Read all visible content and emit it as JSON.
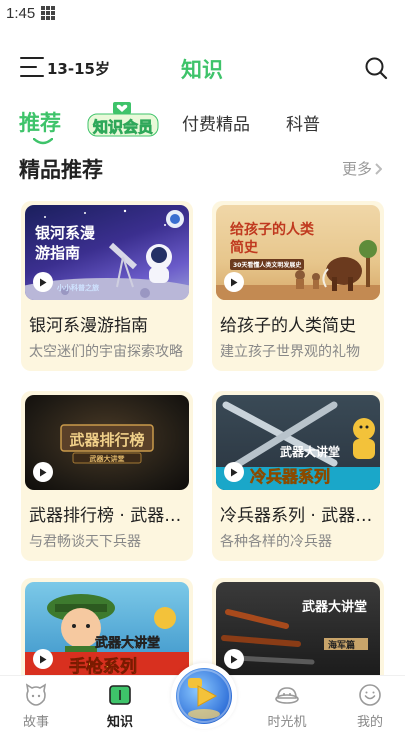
{
  "status_bar": {
    "time": "1:45"
  },
  "header": {
    "age_range": "13-15岁",
    "title": "知识"
  },
  "tabs": [
    {
      "label": "推荐",
      "active": true
    },
    {
      "label": "知识会员",
      "active": false
    },
    {
      "label": "付费精品",
      "active": false
    },
    {
      "label": "科普",
      "active": false
    }
  ],
  "section": {
    "title": "精品推荐",
    "more_label": "更多"
  },
  "cards": [
    {
      "title": "银河系漫游指南",
      "subtitle": "太空迷们的宇宙探索攻略",
      "thumb_text": "银河系漫游指南",
      "thumb_small": "小小科普之旅"
    },
    {
      "title": "给孩子的人类简史",
      "subtitle": "建立孩子世界观的礼物",
      "thumb_text": "给孩子的人类简史",
      "thumb_small": "30天看懂人类文明发展史"
    },
    {
      "title": "武器排行榜 · 武器大讲堂",
      "subtitle": "与君畅谈天下兵器",
      "thumb_text": "武器排行榜",
      "thumb_small": "武器大讲堂"
    },
    {
      "title": "冷兵器系列 · 武器大讲堂",
      "subtitle": "各种各样的冷兵器",
      "thumb_text": "武器大讲堂",
      "thumb_small": "冷兵器系列"
    },
    {
      "title": "",
      "subtitle": "",
      "thumb_text": "武器大讲堂",
      "thumb_small": "手枪系列"
    },
    {
      "title": "",
      "subtitle": "",
      "thumb_text": "武器大讲堂",
      "thumb_small": "海军篇"
    }
  ],
  "bottom_nav": [
    {
      "label": "故事",
      "icon": "story-icon",
      "active": false
    },
    {
      "label": "知识",
      "icon": "knowledge-icon",
      "active": true
    },
    {
      "label": "时光机",
      "icon": "time-machine-icon",
      "active": false
    },
    {
      "label": "我的",
      "icon": "profile-icon",
      "active": false
    }
  ],
  "colors": {
    "accent": "#3ec36a",
    "card_bg": "#fdf6df"
  }
}
